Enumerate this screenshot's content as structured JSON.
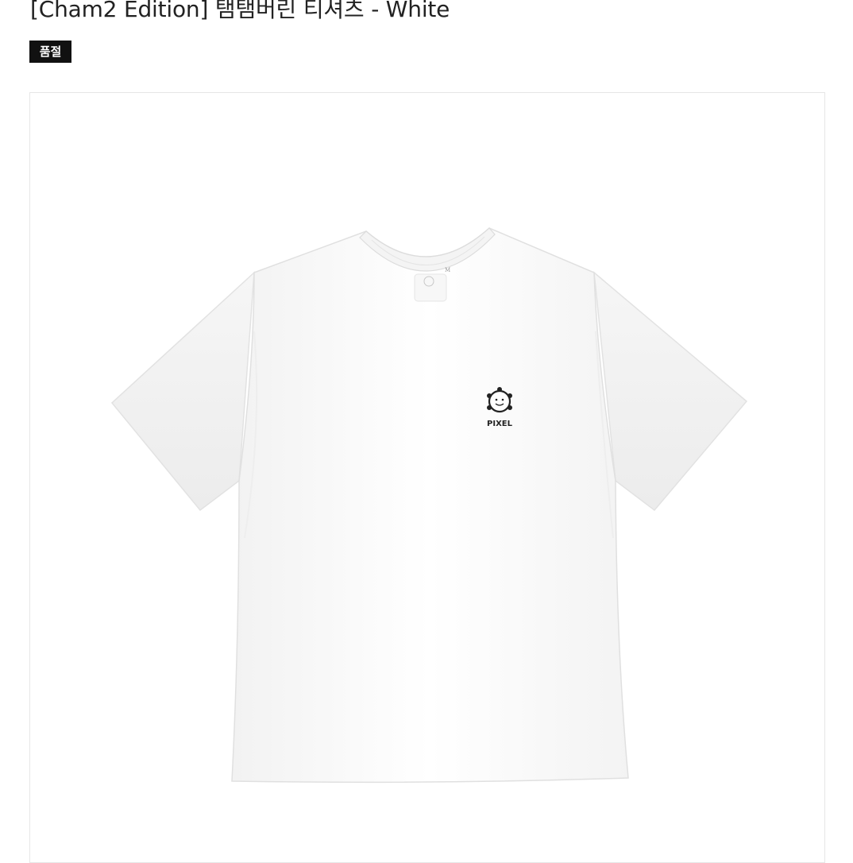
{
  "product": {
    "title": "[Cham2 Edition] 탬탬버린 티셔츠 - White",
    "status_badge": "품절",
    "logo_text": "PIXEL",
    "size_tag": "M"
  },
  "colors": {
    "badge_bg": "#111111",
    "badge_text": "#ffffff",
    "title_text": "#222222",
    "frame_border": "#e6e6e6"
  },
  "icons": {
    "logo": "tambourine-face-icon"
  }
}
